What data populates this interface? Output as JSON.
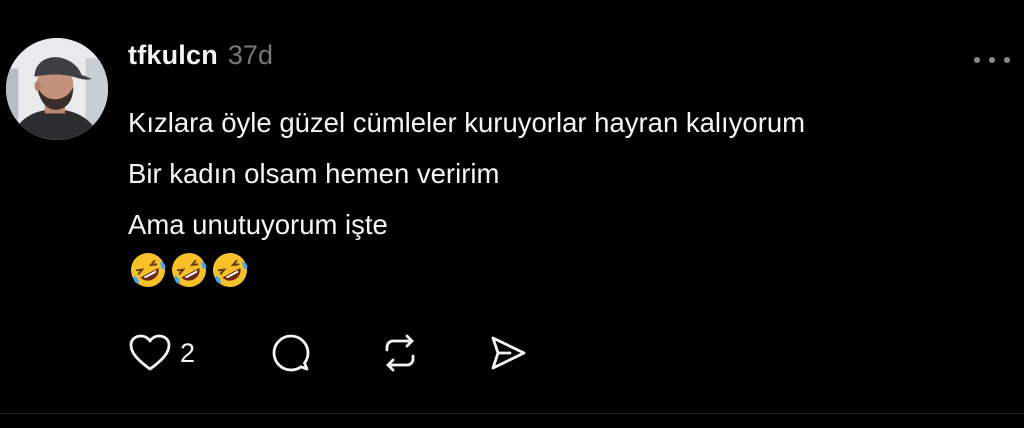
{
  "post": {
    "username": "tfkulcn",
    "time": "37d",
    "lines": [
      "Kızlara öyle güzel cümleler kuruyorlar hayran kalıyorum",
      "Bir kadın olsam hemen veririm",
      "Ama unutuyorum işte"
    ],
    "emoji": "🤣🤣🤣",
    "avatar_icon": "user-avatar",
    "more_icon": "more-horizontal-icon"
  },
  "actions": {
    "like_icon": "heart-icon",
    "like_count": "2",
    "reply_icon": "comment-icon",
    "repost_icon": "repost-icon",
    "share_icon": "send-icon"
  },
  "colors": {
    "background": "#000000",
    "text": "#f3f5f7",
    "muted": "#777777",
    "divider": "#262626"
  }
}
